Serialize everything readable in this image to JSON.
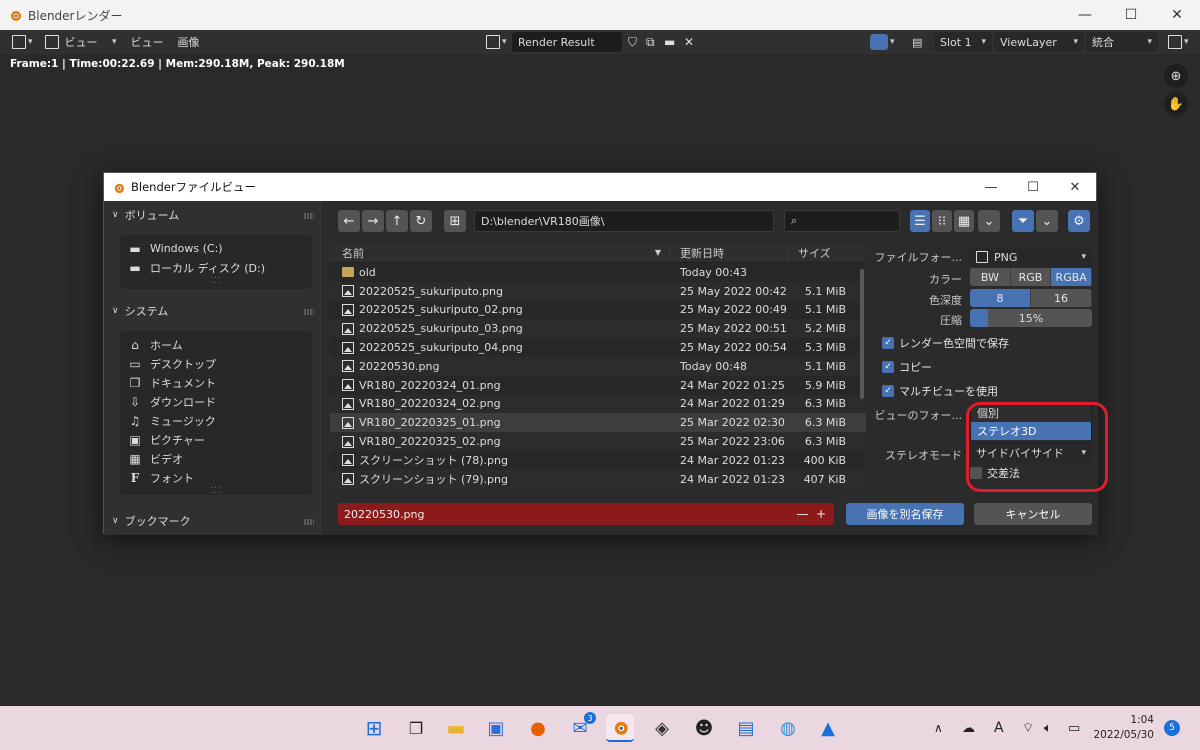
{
  "window": {
    "title": "Blenderレンダー"
  },
  "header": {
    "view_menu": "ビュー",
    "menu_view": "ビュー",
    "menu_image": "画像",
    "image_name": "Render Result",
    "slot": "Slot 1",
    "view_layer": "ViewLayer",
    "pass": "統合"
  },
  "status_text": "Frame:1 | Time:00:22.69 | Mem:290.18M, Peak: 290.18M",
  "dialog": {
    "title": "Blenderファイルビュー",
    "path": "D:\\blender\\VR180画像\\",
    "sidebar": {
      "volumes_title": "ボリューム",
      "volumes": [
        "Windows (C:)",
        "ローカル ディスク (D:)"
      ],
      "system_title": "システム",
      "system": [
        {
          "label": "ホーム",
          "icon": "home-icon"
        },
        {
          "label": "デスクトップ",
          "icon": "desktop-icon"
        },
        {
          "label": "ドキュメント",
          "icon": "documents-icon"
        },
        {
          "label": "ダウンロード",
          "icon": "download-icon"
        },
        {
          "label": "ミュージック",
          "icon": "music-icon"
        },
        {
          "label": "ピクチャー",
          "icon": "picture-icon"
        },
        {
          "label": "ビデオ",
          "icon": "video-icon"
        },
        {
          "label": "フォント",
          "icon": "font-icon"
        }
      ],
      "bookmarks_title": "ブックマーク"
    },
    "columns": {
      "name": "名前",
      "date": "更新日時",
      "size": "サイズ"
    },
    "files": [
      {
        "name": "old",
        "date": "Today 00:43",
        "size": "",
        "type": "folder"
      },
      {
        "name": "20220525_sukuriputo.png",
        "date": "25 May 2022 00:42",
        "size": "5.1 MiB",
        "type": "image"
      },
      {
        "name": "20220525_sukuriputo_02.png",
        "date": "25 May 2022 00:49",
        "size": "5.1 MiB",
        "type": "image"
      },
      {
        "name": "20220525_sukuriputo_03.png",
        "date": "25 May 2022 00:51",
        "size": "5.2 MiB",
        "type": "image"
      },
      {
        "name": "20220525_sukuriputo_04.png",
        "date": "25 May 2022 00:54",
        "size": "5.3 MiB",
        "type": "image"
      },
      {
        "name": "20220530.png",
        "date": "Today 00:48",
        "size": "5.1 MiB",
        "type": "image"
      },
      {
        "name": "VR180_20220324_01.png",
        "date": "24 Mar 2022 01:25",
        "size": "5.9 MiB",
        "type": "image"
      },
      {
        "name": "VR180_20220324_02.png",
        "date": "24 Mar 2022 01:29",
        "size": "6.3 MiB",
        "type": "image"
      },
      {
        "name": "VR180_20220325_01.png",
        "date": "25 Mar 2022 02:30",
        "size": "6.3 MiB",
        "type": "image"
      },
      {
        "name": "VR180_20220325_02.png",
        "date": "25 Mar 2022 23:06",
        "size": "6.3 MiB",
        "type": "image"
      },
      {
        "name": "スクリーンショット (78).png",
        "date": "24 Mar 2022 01:23",
        "size": "400 KiB",
        "type": "image"
      },
      {
        "name": "スクリーンショット (79).png",
        "date": "24 Mar 2022 01:23",
        "size": "407 KiB",
        "type": "image"
      }
    ],
    "props": {
      "file_format_label": "ファイルフォー...",
      "file_format_value": "PNG",
      "color_label": "カラー",
      "color_options": [
        "BW",
        "RGB",
        "RGBA"
      ],
      "color_selected": "RGBA",
      "depth_label": "色深度",
      "depth_options": [
        "8",
        "16"
      ],
      "depth_selected": "8",
      "compression_label": "圧縮",
      "compression_value": "15%",
      "compression_fraction": 0.15,
      "save_colorspace": "レンダー色空間で保存",
      "copy": "コピー",
      "multiview": "マルチビューを使用",
      "view_format_label": "ビューのフォー...",
      "view_format_options": [
        "個別",
        "ステレオ3D"
      ],
      "view_format_selected": "ステレオ3D",
      "stereo_mode_label": "ステレオモード",
      "stereo_mode_value": "サイドバイサイド",
      "cross_eyed": "交差法"
    },
    "filename": "20220530.png",
    "save_button": "画像を別名保存",
    "cancel_button": "キャンセル"
  },
  "taskbar": {
    "mail_badge": "3",
    "time": "1:04",
    "date": "2022/05/30",
    "notification_count": "5"
  },
  "colors": {
    "accent": "#4772b3",
    "filename_bg": "#8b1a1a",
    "annotation": "#e21d2b"
  }
}
